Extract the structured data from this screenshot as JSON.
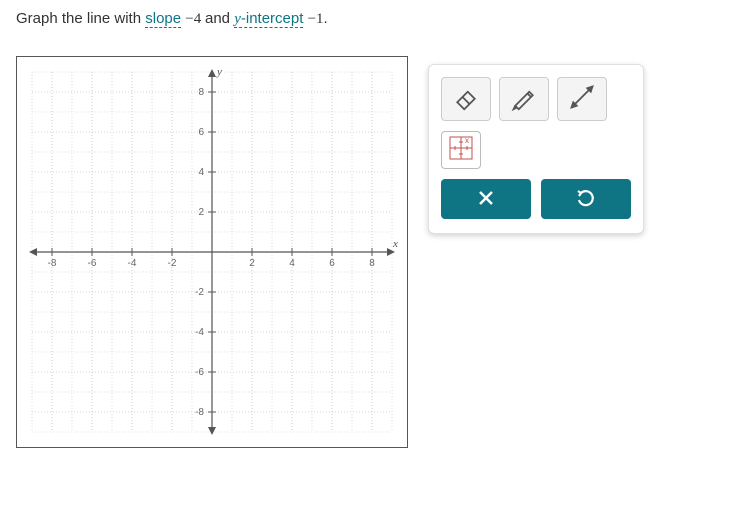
{
  "prompt": {
    "prefix": "Graph the line with ",
    "slope_word": "slope",
    "slope_value": " −4 ",
    "and_word": "and ",
    "yint_word_y": "y",
    "yint_word_rest": "-intercept",
    "yint_value": " −1",
    "end": "."
  },
  "chart_data": {
    "type": "scatter",
    "title": "",
    "xlabel": "x",
    "ylabel": "y",
    "xlim": [
      -9,
      9
    ],
    "ylim": [
      -9,
      9
    ],
    "xticks": [
      -8,
      -6,
      -4,
      -2,
      2,
      4,
      6,
      8
    ],
    "yticks": [
      -8,
      -6,
      -4,
      -2,
      2,
      4,
      6,
      8
    ],
    "grid": true,
    "series": []
  },
  "tools": {
    "eraser_label": "Eraser",
    "pencil_label": "Pencil",
    "line_label": "Line",
    "grid_label": "Grid settings",
    "close_label": "Clear",
    "undo_label": "Undo"
  }
}
